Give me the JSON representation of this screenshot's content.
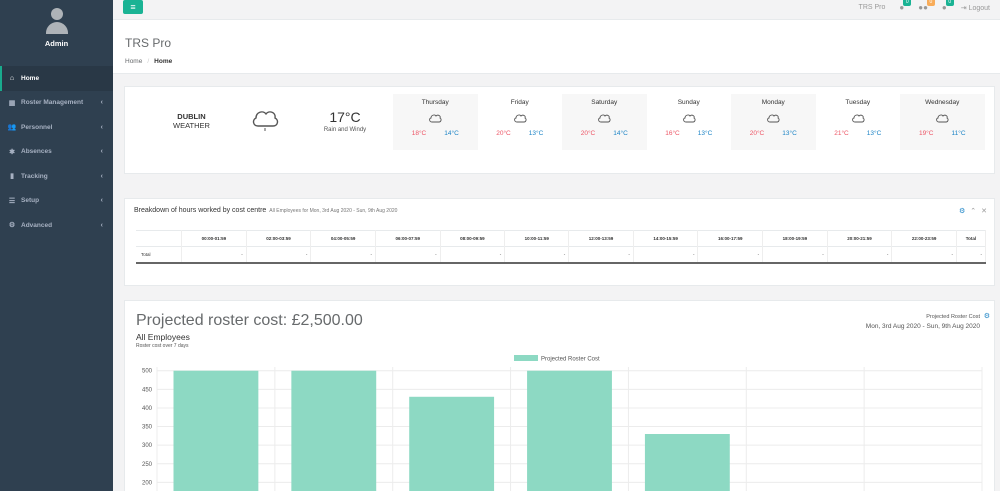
{
  "profile": {
    "name": "Admin"
  },
  "sidebar": {
    "items": [
      {
        "label": "Home",
        "icon": "home-icon",
        "glyph": "⌂",
        "active": true,
        "chevron": false
      },
      {
        "label": "Roster Management",
        "icon": "table-icon",
        "glyph": "▦",
        "active": false,
        "chevron": true
      },
      {
        "label": "Personnel",
        "icon": "users-icon",
        "glyph": "👥",
        "active": false,
        "chevron": true
      },
      {
        "label": "Absences",
        "icon": "asterisk-icon",
        "glyph": "✱",
        "active": false,
        "chevron": true
      },
      {
        "label": "Tracking",
        "icon": "tracking-icon",
        "glyph": "▮",
        "active": false,
        "chevron": true
      },
      {
        "label": "Setup",
        "icon": "list-icon",
        "glyph": "☰",
        "active": false,
        "chevron": true
      },
      {
        "label": "Advanced",
        "icon": "gear-icon",
        "glyph": "⚙",
        "active": false,
        "chevron": true
      }
    ]
  },
  "topbar": {
    "menu_glyph": "≡",
    "app_name": "TRS Pro",
    "badges": [
      {
        "icon": "messages-icon",
        "count": "0",
        "color": "#1ab394"
      },
      {
        "icon": "users-alert-icon",
        "count": "0",
        "color": "#f8ac59"
      },
      {
        "icon": "bell-icon",
        "count": "0",
        "color": "#1ab394"
      }
    ],
    "logout_label": "Logout"
  },
  "heading": {
    "title": "TRS Pro",
    "breadcrumb_home": "Home",
    "breadcrumb_current": "Home"
  },
  "weather": {
    "city": "DUBLIN",
    "label": "WEATHER",
    "current_temp": "17°C",
    "current_desc": "Rain and Windy",
    "days": [
      {
        "name": "Thursday",
        "high": "18°C",
        "low": "14°C"
      },
      {
        "name": "Friday",
        "high": "20°C",
        "low": "13°C"
      },
      {
        "name": "Saturday",
        "high": "20°C",
        "low": "14°C"
      },
      {
        "name": "Sunday",
        "high": "16°C",
        "low": "13°C"
      },
      {
        "name": "Monday",
        "high": "20°C",
        "low": "13°C"
      },
      {
        "name": "Tuesday",
        "high": "21°C",
        "low": "13°C"
      },
      {
        "name": "Wednesday",
        "high": "19°C",
        "low": "11°C"
      }
    ],
    "colors": {
      "high": "#ed5565",
      "low": "#1c84c6"
    }
  },
  "breakdown": {
    "title": "Breakdown of hours worked by cost centre",
    "subtitle": "All Employees for Mon, 3rd Aug 2020 - Sun, 9th Aug 2020",
    "columns": [
      "",
      "00:00-01:59",
      "02:00-03:59",
      "04:00-05:59",
      "06:00-07:59",
      "08:00-09:59",
      "10:00-11:59",
      "12:00-13:59",
      "14:00-15:59",
      "16:00-17:59",
      "18:00-19:59",
      "20:00-21:59",
      "22:00-23:59",
      "Total"
    ],
    "rows": [
      [
        "Total",
        "-",
        "-",
        "-",
        "-",
        "-",
        "-",
        "-",
        "-",
        "-",
        "-",
        "-",
        "-",
        "-"
      ]
    ]
  },
  "projected": {
    "title": "Projected roster cost: £2,500.00",
    "subtitle": "All Employees",
    "note": "Roster cost over 7 days",
    "right_label": "Projected Roster Cost",
    "date_range": "Mon, 3rd Aug 2020 - Sun, 9th Aug 2020"
  },
  "chart_data": {
    "type": "bar",
    "series": [
      {
        "name": "Projected Roster Cost",
        "values": [
          500,
          500,
          430,
          500,
          330,
          0,
          0
        ]
      }
    ],
    "y_ticks": [
      200,
      250,
      300,
      350,
      400,
      450,
      500
    ],
    "ylim": [
      150,
      510
    ],
    "grid": true,
    "legend": "top-center",
    "bar_color": "#8dd9c3"
  }
}
